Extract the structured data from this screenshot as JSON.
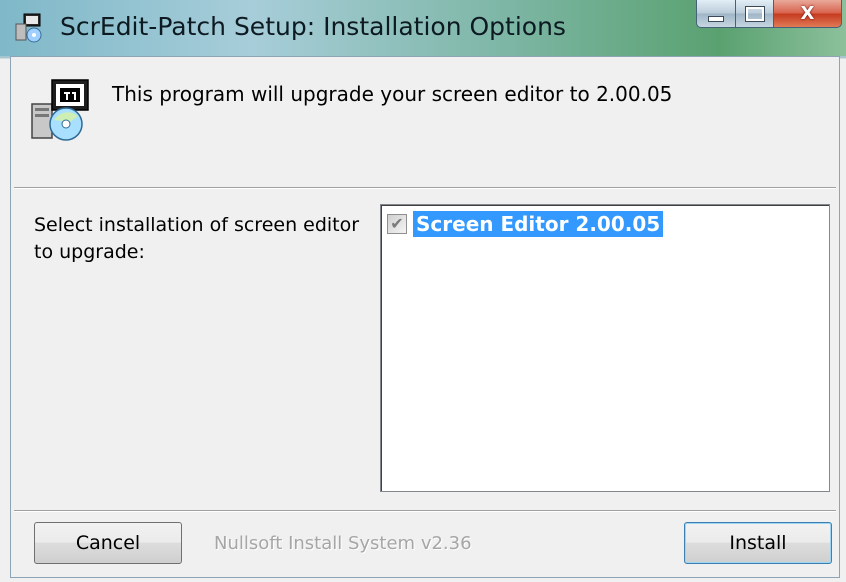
{
  "window": {
    "title": "ScrEdit-Patch Setup: Installation Options",
    "controls": {
      "minimize": "minimize",
      "maximize": "maximize",
      "close": "X"
    }
  },
  "header": {
    "text": "This program will upgrade your screen editor to 2.00.05"
  },
  "options": {
    "label": "Select installation of screen editor to upgrade:",
    "items": [
      {
        "label": "Screen Editor 2.00.05",
        "checked": true,
        "selected": true
      }
    ]
  },
  "footer": {
    "cancel_label": "Cancel",
    "branding": "Nullsoft Install System v2.36",
    "install_label": "Install"
  },
  "colors": {
    "selection": "#3399ff",
    "window_bg": "#f0f0f0",
    "close_button": "#c5391f"
  }
}
